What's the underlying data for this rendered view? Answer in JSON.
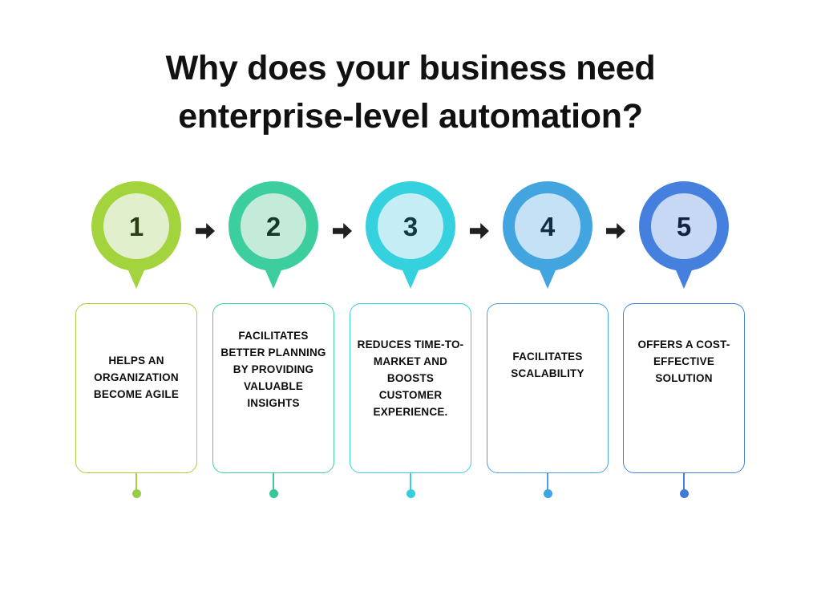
{
  "slide": {
    "background_color": "#ffffff"
  },
  "title": {
    "line1": "Why does your business need",
    "line2": "enterprise-level automation?",
    "full": "Why does your business need enterprise-level automation?",
    "color": "#111111"
  },
  "arrows": {
    "icon": "arrow-right-icon",
    "glyph": "➡",
    "color": "#231f20",
    "count": 4
  },
  "steps": [
    {
      "number": "1",
      "ring_color": "#a3d33d",
      "inner_color": "#e2efcd",
      "number_color": "#2b3d12",
      "border_color": "#a8ce3e",
      "stem_color": "#a8ce3e",
      "dot_color": "#96cc4b",
      "text": "HELPS AN ORGANIZATION BECOME AGILE"
    },
    {
      "number": "2",
      "ring_color": "#3dcea0",
      "inner_color": "#c4ead9",
      "number_color": "#123a2a",
      "border_color": "#3fcca0",
      "stem_color": "#3fcca0",
      "dot_color": "#35c79b",
      "text": "FACILITATES BETTER PLANNING BY PROVIDING VALUABLE INSIGHTS"
    },
    {
      "number": "3",
      "ring_color": "#36d1de",
      "inner_color": "#c5edf5",
      "number_color": "#113a42",
      "border_color": "#3bcfe0",
      "stem_color": "#3bcfe0",
      "dot_color": "#35cede",
      "text": "REDUCES TIME-TO-MARKET AND BOOSTS CUSTOMER EXPERIENCE."
    },
    {
      "number": "4",
      "ring_color": "#42a5e0",
      "inner_color": "#c5e1f5",
      "number_color": "#0f2c44",
      "border_color": "#46a3de",
      "stem_color": "#46a3de",
      "dot_color": "#3ea4e2",
      "text": "FACILITATES SCALABILITY"
    },
    {
      "number": "5",
      "ring_color": "#4580de",
      "inner_color": "#c7d8f5",
      "number_color": "#13233f",
      "border_color": "#4680dc",
      "stem_color": "#4680dc",
      "dot_color": "#4179d6",
      "text": "OFFERS A COST-EFFECTIVE SOLUTION"
    }
  ]
}
